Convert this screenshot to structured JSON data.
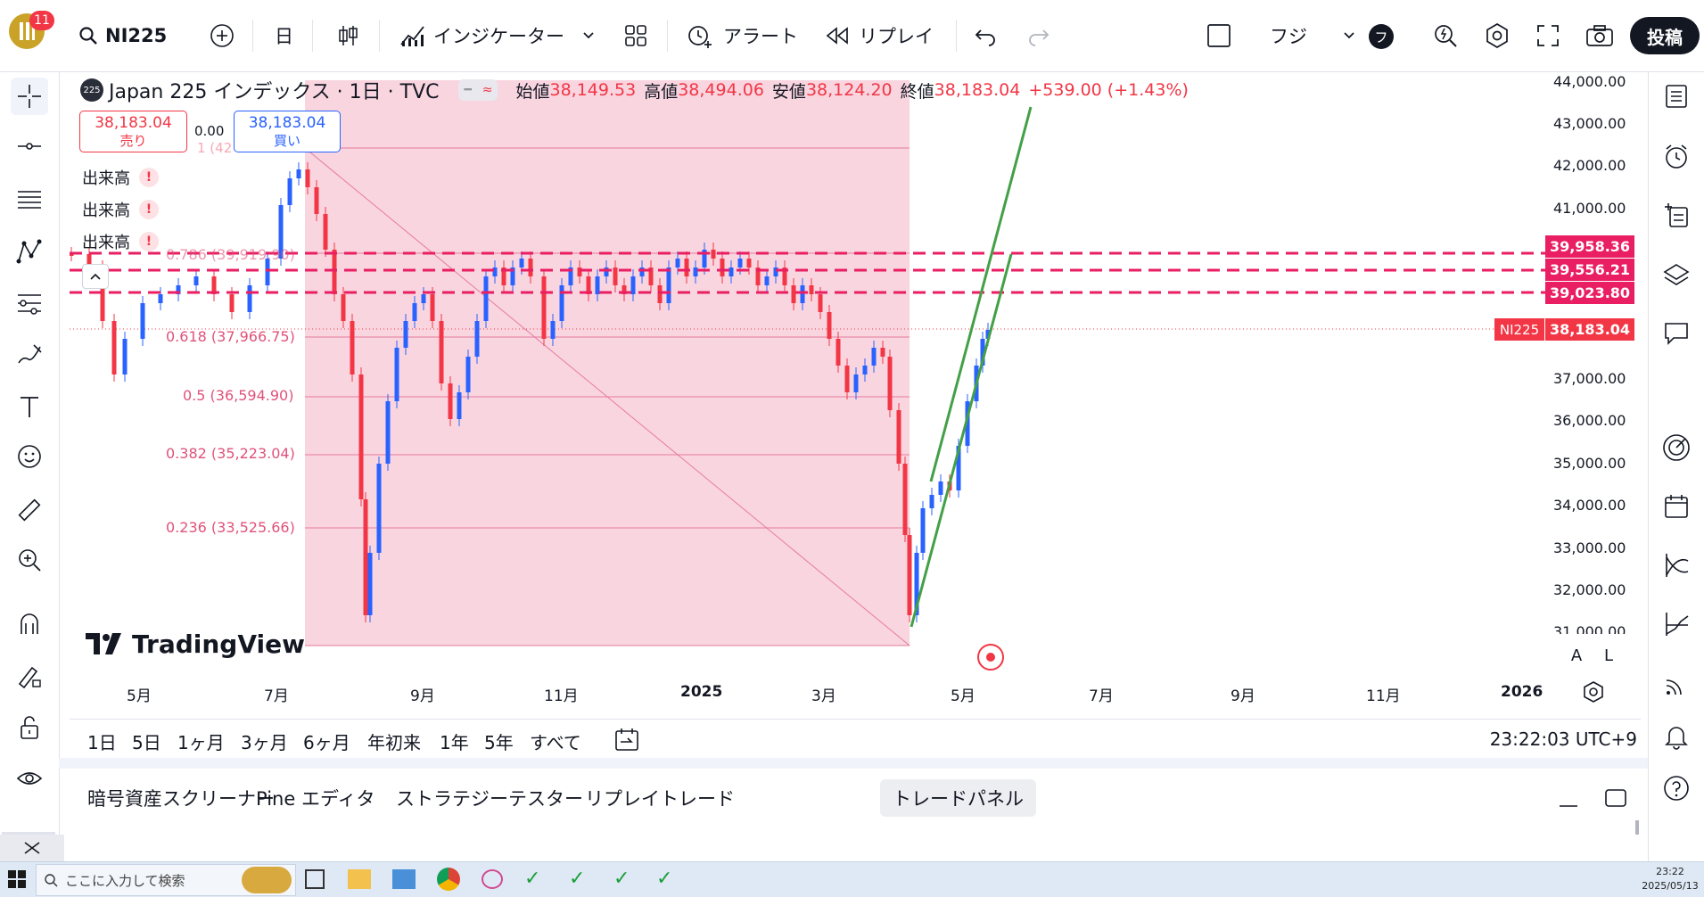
{
  "topbar": {
    "notif_count": "11",
    "symbol": "NI225",
    "interval": "日",
    "indicators_label": "インジケーター",
    "alert_label": "アラート",
    "replay_label": "リプレイ",
    "account_label": "フジ",
    "avatar_letter": "フ",
    "publish_label": "投稿"
  },
  "legend": {
    "badge": "225",
    "title": "Japan 225 インデックス · 1日 · TVC",
    "open_label": "始値",
    "open": "38,149.53",
    "high_label": "高値",
    "high": "38,494.06",
    "low_label": "安値",
    "low": "38,124.20",
    "close_label": "終値",
    "close": "38,183.04",
    "change": "+539.00 (+1.43%)"
  },
  "trade": {
    "sell_price": "38,183.04",
    "sell_label": "売り",
    "spread": "0.00",
    "buy_price": "38,183.04",
    "buy_label": "買い",
    "hidden_text": "1 (42"
  },
  "indicators": [
    "出来高",
    "出来高",
    "出来高"
  ],
  "fib_levels": [
    {
      "label": "0.786 (39,919.90)"
    },
    {
      "label": "0.618 (37,966.75)"
    },
    {
      "label": "0.5 (36,594.90)"
    },
    {
      "label": "0.382 (35,223.04)"
    },
    {
      "label": "0.236 (33,525.66)"
    }
  ],
  "price_axis": [
    "44,000.00",
    "43,000.00",
    "42,000.00",
    "41,000.00",
    "37,000.00",
    "36,000.00",
    "35,000.00",
    "34,000.00",
    "33,000.00",
    "32,000.00",
    "31,000.00"
  ],
  "price_tags": {
    "alert1": "39,958.36",
    "alert2": "39,556.21",
    "alert3": "39,023.80",
    "symbol": "NI225",
    "last": "38,183.04"
  },
  "time_axis": [
    "5月",
    "7月",
    "9月",
    "11月",
    "2025",
    "3月",
    "5月",
    "7月",
    "9月",
    "11月",
    "2026"
  ],
  "watermark": "TradingView",
  "scale_buttons": {
    "auto": "A",
    "log": "L"
  },
  "ranges": [
    "1日",
    "5日",
    "1ヶ月",
    "3ヶ月",
    "6ヶ月",
    "年初来",
    "1年",
    "5年",
    "すべて"
  ],
  "clock": "23:22:03 UTC+9",
  "bottom_tabs": [
    "暗号資産スクリーナー",
    "Pine エディタ",
    "ストラテジーテスター",
    "リプレイトレード",
    "トレードパネル"
  ],
  "taskbar": {
    "search_placeholder": "ここに入力して検索",
    "time": "23:22",
    "date": "2025/05/13"
  },
  "colors": {
    "red": "#f23645",
    "blue": "#2962ff",
    "fib_fill": "#f9d5e0",
    "green_channel": "#43a047",
    "alert_line": "#e91e63"
  }
}
